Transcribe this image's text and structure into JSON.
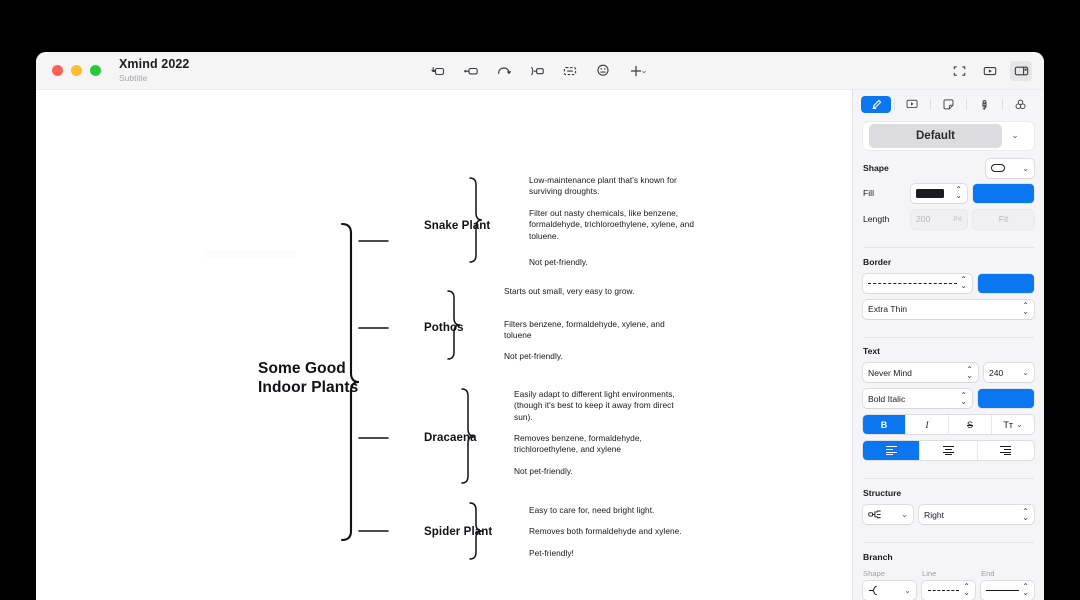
{
  "window": {
    "title": "Xmind 2022",
    "subtitle": "Subtitle",
    "traffic_lights": [
      "close",
      "minimize",
      "maximize"
    ]
  },
  "toolbar": {
    "center_items": [
      {
        "name": "insert-topic-icon",
        "label": "Topic"
      },
      {
        "name": "insert-subtopic-icon",
        "label": "Subtopic"
      },
      {
        "name": "undo-icon",
        "label": "Undo"
      },
      {
        "name": "insert-relationship-icon",
        "label": "Relationship"
      },
      {
        "name": "insert-boundary-icon",
        "label": "Boundary"
      },
      {
        "name": "insert-sticker-icon",
        "label": "Sticker"
      },
      {
        "name": "insert-more-icon",
        "label": "More"
      }
    ],
    "right_items": [
      {
        "name": "zen-mode-icon",
        "label": "Zen Mode"
      },
      {
        "name": "presentation-icon",
        "label": "Presentation"
      },
      {
        "name": "toggle-panel-icon",
        "label": "Format Panel",
        "active": true
      }
    ]
  },
  "panel": {
    "tabs": [
      {
        "name": "format-tab",
        "icon": "brush-icon",
        "active": true
      },
      {
        "name": "slide-tab",
        "icon": "slide-icon",
        "active": false
      },
      {
        "name": "notes-tab",
        "icon": "note-icon",
        "active": false
      },
      {
        "name": "shortcuts-tab",
        "icon": "command-icon",
        "active": false
      },
      {
        "name": "advanced-tab",
        "icon": "circles-icon",
        "active": false
      }
    ],
    "theme": {
      "label": "Default",
      "caret": "⌄"
    },
    "shape": {
      "title": "Shape",
      "shape_value": "rounded-rect",
      "fill_label": "Fill",
      "fill_color": "#1b1b1f",
      "fill_accent": "#0a76f0",
      "length_label": "Length",
      "length_value": "200",
      "length_unit": "PX",
      "fit_label": "Fit"
    },
    "border": {
      "title": "Border",
      "style_value": "dashed",
      "color": "#0a76f0",
      "weight_value": "Extra Thin"
    },
    "text": {
      "title": "Text",
      "font_value": "Never Mind",
      "size_value": "240",
      "style_value": "Bold Italic",
      "color": "#0a76f0",
      "bold_label": "B",
      "italic_label": "I",
      "strike_label": "S",
      "case_label": "Tᴛ",
      "bold_active": true,
      "italic_active": false,
      "strike_active": false,
      "align_active": "left"
    },
    "structure": {
      "title": "Structure",
      "icon_value": "structure-icon",
      "direction_value": "Right"
    },
    "branch": {
      "title": "Branch",
      "shape_label": "Shape",
      "line_label": "Line",
      "end_label": "End",
      "shape_value": "brace",
      "line_value": "dashed",
      "end_value": "solid"
    }
  },
  "mindmap": {
    "central": "Some Good\nIndoor Plants",
    "branches": [
      {
        "topic": "Snake Plant",
        "items": [
          "Low-maintenance plant that's known for surviving droughts.",
          "Filter out nasty chemicals, like benzene, formaldehyde, trichloroethylene, xylene, and toluene.",
          "Not pet-friendly."
        ]
      },
      {
        "topic": "Pothos",
        "items": [
          "Starts out small, very easy to grow.",
          "Filters benzene, formaldehyde, xylene, and toluene",
          "Not pet-friendly."
        ]
      },
      {
        "topic": "Dracaena",
        "items": [
          "Easily adapt to different light environments, (though it's best to keep it away from direct sun).",
          "Removes benzene, formaldehyde, trichloroethylene, and xylene",
          "Not pet-friendly."
        ]
      },
      {
        "topic": "Spider Plant",
        "items": [
          "Easy to care for, need bright light.",
          "Removes both formaldehyde and xylene.",
          "Pet-friendly!"
        ]
      }
    ]
  },
  "colors": {
    "accent": "#0a76f0",
    "panel_bg": "#f5f5f7",
    "titlebar_bg": "#f5f5f5",
    "canvas_bg": "#ffffff",
    "page_bg": "#000000"
  }
}
